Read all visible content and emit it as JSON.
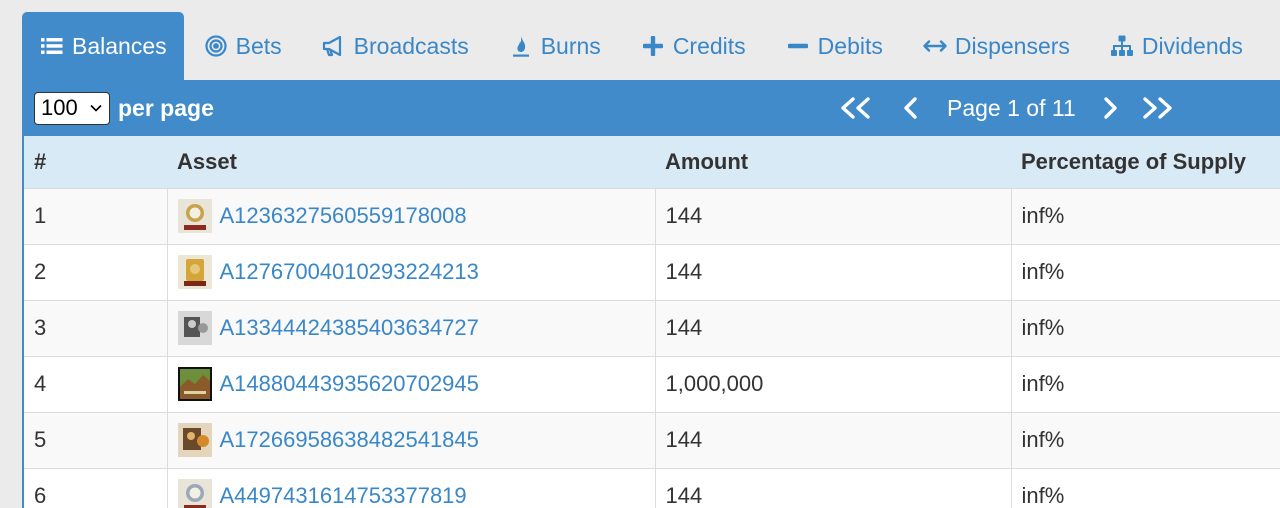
{
  "tabs": [
    {
      "label": "Balances",
      "icon": "list-icon",
      "active": true
    },
    {
      "label": "Bets",
      "icon": "bullseye-icon"
    },
    {
      "label": "Broadcasts",
      "icon": "bullhorn-icon"
    },
    {
      "label": "Burns",
      "icon": "flame-icon"
    },
    {
      "label": "Credits",
      "icon": "plus-icon"
    },
    {
      "label": "Debits",
      "icon": "minus-icon"
    },
    {
      "label": "Dispensers",
      "icon": "arrows-h-icon"
    },
    {
      "label": "Dividends",
      "icon": "sitemap-icon"
    }
  ],
  "toolbar": {
    "per_page_value": "100",
    "per_page_label": "per page",
    "page_text": "Page 1 of 11"
  },
  "table": {
    "headers": [
      "#",
      "Asset",
      "Amount",
      "Percentage of Supply"
    ],
    "rows": [
      {
        "num": "1",
        "asset": "A1236327560559178008",
        "amount": "144",
        "percent": "inf%",
        "thumb": "stamp-gold"
      },
      {
        "num": "2",
        "asset": "A12767004010293224213",
        "amount": "144",
        "percent": "inf%",
        "thumb": "stamp-gold2"
      },
      {
        "num": "3",
        "asset": "A13344424385403634727",
        "amount": "144",
        "percent": "inf%",
        "thumb": "stamp-gray"
      },
      {
        "num": "4",
        "asset": "A14880443935620702945",
        "amount": "1,000,000",
        "percent": "inf%",
        "thumb": "landscape"
      },
      {
        "num": "5",
        "asset": "A17266958638482541845",
        "amount": "144",
        "percent": "inf%",
        "thumb": "stamp-orange"
      },
      {
        "num": "6",
        "asset": "A4497431614753377819",
        "amount": "144",
        "percent": "inf%",
        "thumb": "stamp-gold"
      }
    ]
  },
  "colors": {
    "accent": "#428bca",
    "link": "#3a87c8",
    "header_bg": "#d9eaf7"
  }
}
